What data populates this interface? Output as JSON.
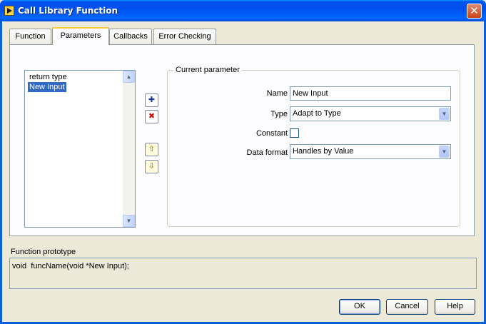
{
  "window": {
    "title": "Call Library Function",
    "close_glyph": "✕",
    "icon": "labview-icon"
  },
  "tabs": [
    {
      "label": "Function",
      "active": false
    },
    {
      "label": "Parameters",
      "active": true
    },
    {
      "label": "Callbacks",
      "active": false
    },
    {
      "label": "Error Checking",
      "active": false
    }
  ],
  "parameters": {
    "list": [
      {
        "label": "return type",
        "selected": false
      },
      {
        "label": "New Input",
        "selected": true
      }
    ],
    "buttons": {
      "add_glyph": "✚",
      "remove_glyph": "✖",
      "up_glyph": "⇧",
      "down_glyph": "⇩"
    },
    "current": {
      "group_title": "Current parameter",
      "name_label": "Name",
      "name_value": "New Input",
      "type_label": "Type",
      "type_value": "Adapt to Type",
      "constant_label": "Constant",
      "constant_checked": false,
      "format_label": "Data format",
      "format_value": "Handles by Value"
    }
  },
  "prototype": {
    "label": "Function prototype",
    "value": "void  funcName(void *New Input);"
  },
  "footer": {
    "ok": "OK",
    "cancel": "Cancel",
    "help": "Help"
  },
  "colors": {
    "titlebar": "#0053ee",
    "selection": "#316ac5",
    "tab_highlight": "#ffc83c",
    "add_icon": "#1a3c9c",
    "remove_icon": "#d01010",
    "arrow_icon": "#d7b800"
  }
}
